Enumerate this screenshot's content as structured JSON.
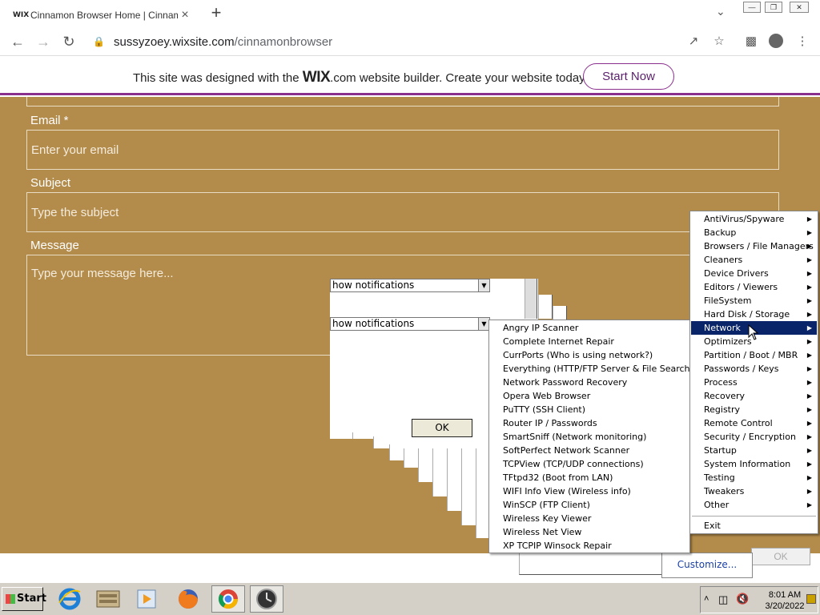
{
  "browser": {
    "tab_favicon": "WIX",
    "tab_title": "Cinnamon Browser Home | Cinnamon",
    "tab_close": "×",
    "new_tab": "+",
    "url_host": "sussyzoey.wixsite.com",
    "url_path": "/cinnamonbrowser"
  },
  "wix_banner": {
    "text_before": "This site was designed with the ",
    "logo": "WIX",
    "text_after": ".com website builder. Create your website today.",
    "button": "Start Now"
  },
  "form": {
    "email_label": "Email *",
    "email_placeholder": "Enter your email",
    "subject_label": "Subject",
    "subject_placeholder": "Type the subject",
    "message_label": "Message",
    "message_placeholder": "Type your message here..."
  },
  "dialog": {
    "dropdown1": "how notifications",
    "dropdown2": "how notifications",
    "ok": "OK",
    "ok2": "OK",
    "customize": "Customize..."
  },
  "main_menu": {
    "items": [
      {
        "label": "AntiVirus/Spyware",
        "submenu": true
      },
      {
        "label": "Backup",
        "submenu": true
      },
      {
        "label": "Browsers / File Managers",
        "submenu": true
      },
      {
        "label": "Cleaners",
        "submenu": true
      },
      {
        "label": "Device Drivers",
        "submenu": true
      },
      {
        "label": "Editors / Viewers",
        "submenu": true
      },
      {
        "label": "FileSystem",
        "submenu": true
      },
      {
        "label": "Hard Disk / Storage",
        "submenu": true
      },
      {
        "label": "Network",
        "submenu": true,
        "selected": true
      },
      {
        "label": "Optimizers",
        "submenu": true
      },
      {
        "label": "Partition / Boot / MBR",
        "submenu": true
      },
      {
        "label": "Passwords / Keys",
        "submenu": true
      },
      {
        "label": "Process",
        "submenu": true
      },
      {
        "label": "Recovery",
        "submenu": true
      },
      {
        "label": "Registry",
        "submenu": true
      },
      {
        "label": "Remote Control",
        "submenu": true
      },
      {
        "label": "Security / Encryption",
        "submenu": true
      },
      {
        "label": "Startup",
        "submenu": true
      },
      {
        "label": "System Information",
        "submenu": true
      },
      {
        "label": "Testing",
        "submenu": true
      },
      {
        "label": "Tweakers",
        "submenu": true
      },
      {
        "label": "Other",
        "submenu": true
      }
    ],
    "exit": "Exit"
  },
  "network_menu": {
    "items": [
      "Angry IP Scanner",
      "Complete Internet Repair",
      "CurrPorts (Who is using network?)",
      "Everything (HTTP/FTP Server & File Search)",
      "Network Password Recovery",
      "Opera Web Browser",
      "PuTTY (SSH Client)",
      "Router IP / Passwords",
      "SmartSniff (Network monitoring)",
      "SoftPerfect Network Scanner",
      "TCPView (TCP/UDP connections)",
      "TFtpd32 (Boot from LAN)",
      "WIFI Info View (Wireless info)",
      "WinSCP (FTP Client)",
      "Wireless Key Viewer",
      "Wireless Net View",
      "XP TCPIP Winsock Repair"
    ]
  },
  "taskbar": {
    "start": "Start",
    "apps": [
      "internet-explorer",
      "file-manager",
      "media-player",
      "firefox",
      "chrome",
      "clock-app"
    ],
    "time": "8:01 AM",
    "date": "3/20/2022"
  },
  "colors": {
    "page_bg": "#b38b4b",
    "wix_accent": "#8b2f8f",
    "menu_highlight": "#0a246a"
  }
}
